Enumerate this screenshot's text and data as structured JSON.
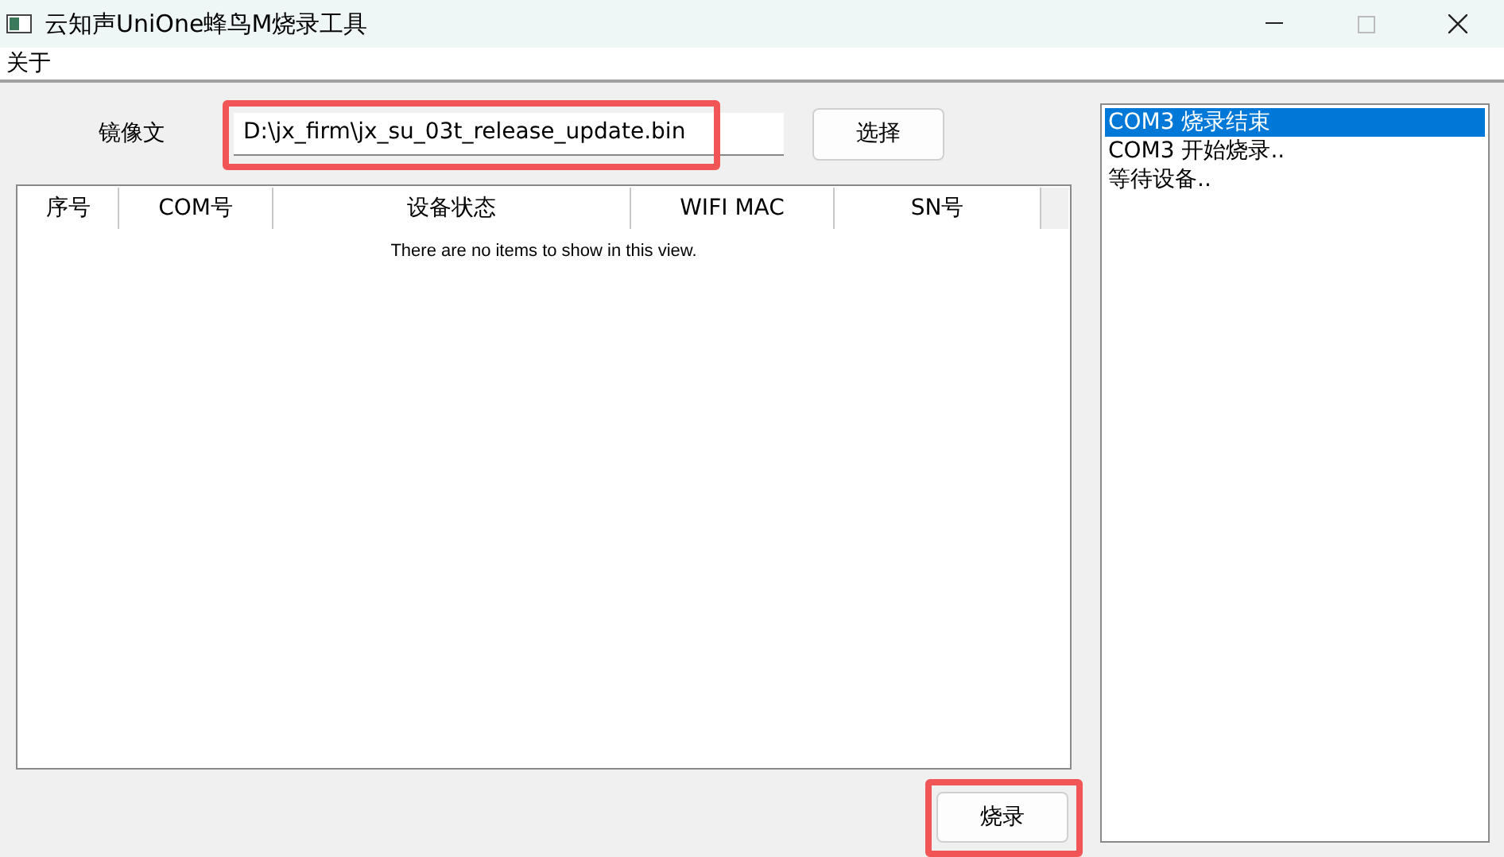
{
  "window": {
    "title": "云知声UniOne蜂鸟M烧录工具",
    "maximize_disabled": true
  },
  "menu": [
    "关于"
  ],
  "image_file": {
    "label": "镜像文",
    "value": "D:\\jx_firm\\jx_su_03t_release_update.bin"
  },
  "select_button": "选择",
  "table": {
    "columns": [
      "序号",
      "COM号",
      "设备状态",
      "WIFI MAC",
      "SN号"
    ],
    "empty_message": "There are no items to show in this view."
  },
  "log": [
    {
      "text": "COM3 烧录结束",
      "selected": true
    },
    {
      "text": "COM3 开始烧录..",
      "selected": false
    },
    {
      "text": "等待设备..",
      "selected": false
    }
  ],
  "burn_button": "烧录"
}
